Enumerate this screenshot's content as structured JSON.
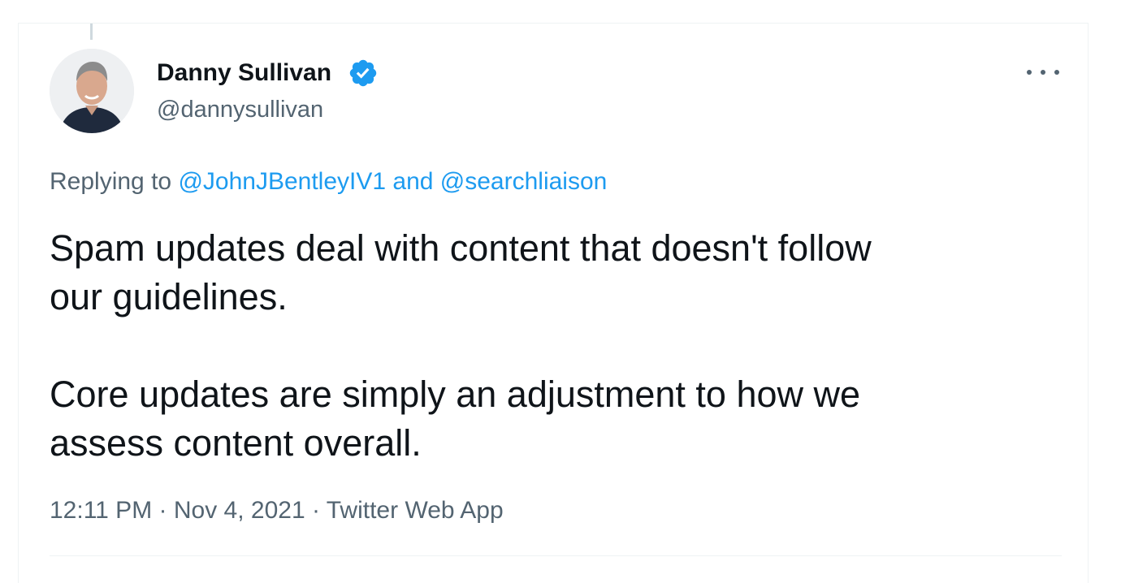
{
  "author": {
    "display_name": "Danny Sullivan",
    "handle": "@dannysullivan",
    "verified": true
  },
  "reply": {
    "prefix": "Replying to",
    "mention_1": "@JohnJBentleyIV1",
    "conjunction": "and",
    "mention_2": "@searchliaison"
  },
  "tweet": {
    "paragraph_1_line_1": "Spam updates deal with content that doesn't follow",
    "paragraph_1_line_2": "our guidelines.",
    "paragraph_2_line_1": "Core updates are simply an adjustment to how we",
    "paragraph_2_line_2": "assess content overall."
  },
  "meta": {
    "time": "12:11 PM",
    "separator": " · ",
    "date": "Nov 4, 2021",
    "source": "Twitter Web App"
  },
  "icons": {
    "verified": "verified-badge-icon",
    "more": "more-options-icon"
  },
  "colors": {
    "accent": "#1d9bf0",
    "text_primary": "#0f1419",
    "text_secondary": "#536471"
  }
}
